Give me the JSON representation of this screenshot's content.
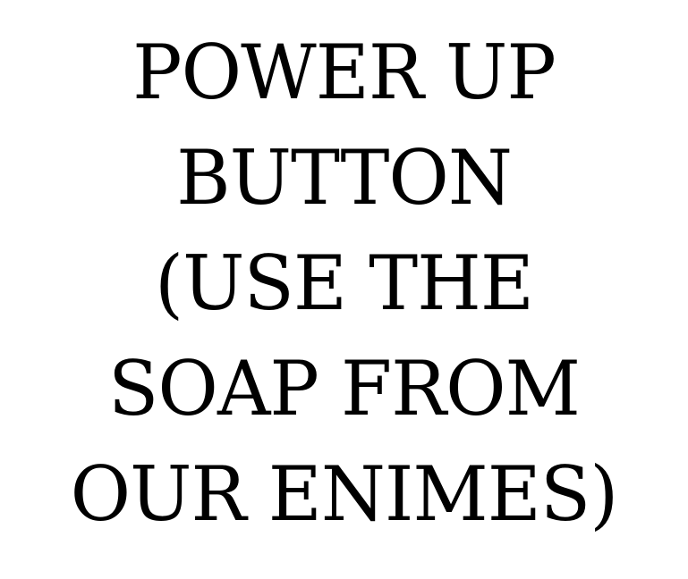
{
  "caption": {
    "lines": [
      "POWER UP",
      "BUTTON",
      "(USE THE",
      "SOAP FROM",
      "OUR ENIMES)"
    ]
  }
}
